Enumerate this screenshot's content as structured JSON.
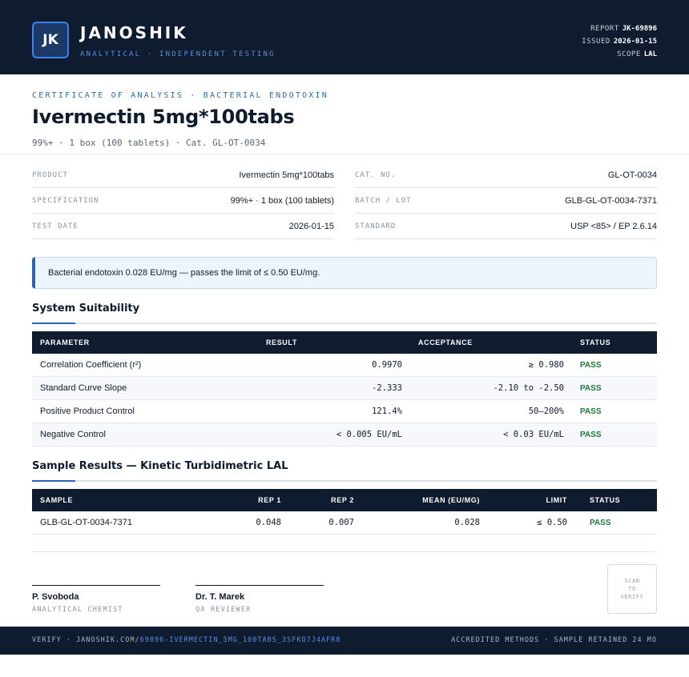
{
  "header": {
    "logo_initials": "JK",
    "brand": "JANOSHIK",
    "tagline": "ANALYTICAL · INDEPENDENT TESTING",
    "report_label": "REPORT",
    "report_value": "JK-69896",
    "issued_label": "ISSUED",
    "issued_value": "2026-01-15",
    "scope_label": "SCOPE",
    "scope_value": "LAL"
  },
  "title_block": {
    "kicker": "CERTIFICATE OF ANALYSIS · BACTERIAL ENDOTOXIN",
    "title": "Ivermectin 5mg*100tabs",
    "subtitle": "99%+ · 1 box (100 tablets)  ·  Cat. GL-OT-0034"
  },
  "info": {
    "left": [
      {
        "label": "PRODUCT",
        "value": "Ivermectin 5mg*100tabs"
      },
      {
        "label": "SPECIFICATION",
        "value": "99%+ · 1 box (100 tablets)"
      },
      {
        "label": "TEST DATE",
        "value": "2026-01-15"
      }
    ],
    "right": [
      {
        "label": "CAT. NO.",
        "value": "GL-OT-0034"
      },
      {
        "label": "BATCH / LOT",
        "value": "GLB-GL-OT-0034-7371"
      },
      {
        "label": "STANDARD",
        "value": "USP <85> / EP 2.6.14"
      }
    ]
  },
  "callout": "Bacterial endotoxin 0.028 EU/mg — passes the limit of ≤ 0.50 EU/mg.",
  "system_suitability": {
    "title": "System Suitability",
    "headers": [
      "PARAMETER",
      "RESULT",
      "ACCEPTANCE",
      "STATUS"
    ],
    "rows": [
      {
        "parameter": "Correlation Coefficient (r²)",
        "result": "0.9970",
        "acceptance": "≥ 0.980",
        "status": "PASS"
      },
      {
        "parameter": "Standard Curve Slope",
        "result": "-2.333",
        "acceptance": "-2.10 to -2.50",
        "status": "PASS"
      },
      {
        "parameter": "Positive Product Control",
        "result": "121.4%",
        "acceptance": "50–200%",
        "status": "PASS"
      },
      {
        "parameter": "Negative Control",
        "result": "< 0.005 EU/mL",
        "acceptance": "< 0.03 EU/mL",
        "status": "PASS"
      }
    ]
  },
  "sample_results": {
    "title": "Sample Results — Kinetic Turbidimetric LAL",
    "headers": [
      "SAMPLE",
      "REP 1",
      "REP 2",
      "MEAN (EU/MG)",
      "LIMIT",
      "STATUS"
    ],
    "rows": [
      {
        "sample": "GLB-GL-OT-0034-7371",
        "rep1": "0.048",
        "rep2": "0.007",
        "mean": "0.028",
        "limit": "≤ 0.50",
        "status": "PASS"
      }
    ]
  },
  "signatures": [
    {
      "name": "P. Svoboda",
      "role": "ANALYTICAL CHEMIST"
    },
    {
      "name": "Dr. T. Marek",
      "role": "QA REVIEWER"
    }
  ],
  "qr": {
    "line1": "SCAN",
    "line2": "TO",
    "line3": "VERIFY"
  },
  "footer": {
    "verify_prefix": "VERIFY · JANOSHIK.COM/",
    "verify_link": "69896-IVERMECTIN_5MG_100TABS_3SFKQ7J4AFR8",
    "right": "ACCREDITED METHODS · SAMPLE RETAINED 24 MO"
  },
  "colors": {
    "header_bg": "#0f1b2e",
    "accent": "#2a64b6",
    "pass": "#1e7a3a"
  }
}
